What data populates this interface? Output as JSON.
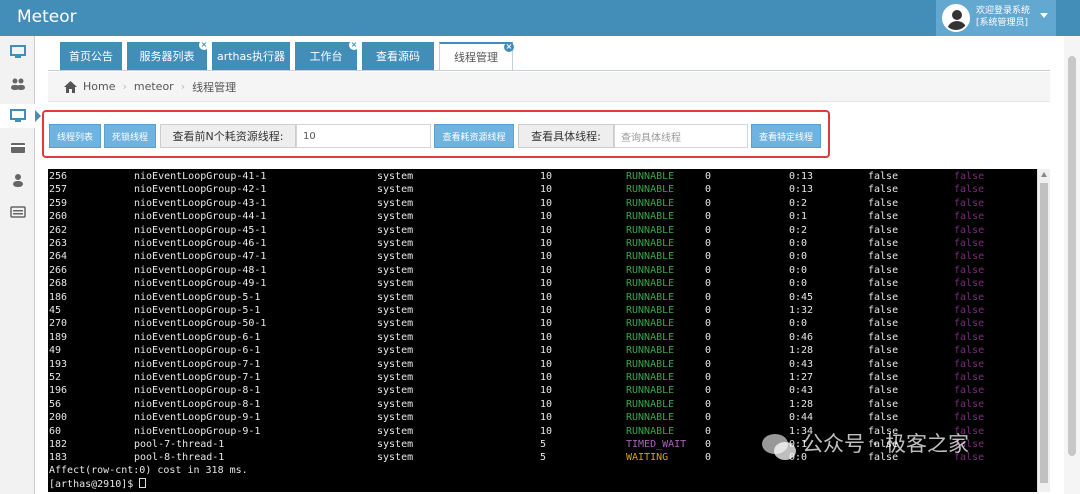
{
  "app": {
    "title": "Meteor"
  },
  "user": {
    "line1": "欢迎登录系统",
    "line2": "[系统管理员]"
  },
  "sidebar": {
    "items": [
      {
        "icon": "desktop-icon"
      },
      {
        "icon": "users-icon"
      },
      {
        "icon": "monitor-icon",
        "active": true
      },
      {
        "icon": "credit-card-icon"
      },
      {
        "icon": "user-icon"
      },
      {
        "icon": "list-icon"
      }
    ]
  },
  "tabs": [
    {
      "label": "首页公告",
      "closable": false
    },
    {
      "label": "服务器列表",
      "closable": true
    },
    {
      "label": "arthas执行器",
      "closable": false
    },
    {
      "label": "工作台",
      "closable": true
    },
    {
      "label": "查看源码",
      "closable": false
    },
    {
      "label": "线程管理",
      "closable": true,
      "active": true
    }
  ],
  "breadcrumb": {
    "home": "Home",
    "app": "meteor",
    "current": "线程管理"
  },
  "toolbar": {
    "thread_list": "线程列表",
    "deadlock": "死锁线程",
    "top_n_label": "查看前N个耗资源线程:",
    "top_n_value": "10",
    "top_n_button": "查看耗资源线程",
    "specific_label": "查看具体线程:",
    "specific_placeholder": "查询具体线程",
    "specific_button": "查看特定线程"
  },
  "console": {
    "rows": [
      [
        "256",
        "nioEventLoopGroup-41-1",
        "system",
        "10",
        "RUNNABLE",
        "0",
        "0:13",
        "false",
        "false"
      ],
      [
        "257",
        "nioEventLoopGroup-42-1",
        "system",
        "10",
        "RUNNABLE",
        "0",
        "0:13",
        "false",
        "false"
      ],
      [
        "259",
        "nioEventLoopGroup-43-1",
        "system",
        "10",
        "RUNNABLE",
        "0",
        "0:2",
        "false",
        "false"
      ],
      [
        "260",
        "nioEventLoopGroup-44-1",
        "system",
        "10",
        "RUNNABLE",
        "0",
        "0:1",
        "false",
        "false"
      ],
      [
        "262",
        "nioEventLoopGroup-45-1",
        "system",
        "10",
        "RUNNABLE",
        "0",
        "0:2",
        "false",
        "false"
      ],
      [
        "263",
        "nioEventLoopGroup-46-1",
        "system",
        "10",
        "RUNNABLE",
        "0",
        "0:0",
        "false",
        "false"
      ],
      [
        "264",
        "nioEventLoopGroup-47-1",
        "system",
        "10",
        "RUNNABLE",
        "0",
        "0:0",
        "false",
        "false"
      ],
      [
        "266",
        "nioEventLoopGroup-48-1",
        "system",
        "10",
        "RUNNABLE",
        "0",
        "0:0",
        "false",
        "false"
      ],
      [
        "268",
        "nioEventLoopGroup-49-1",
        "system",
        "10",
        "RUNNABLE",
        "0",
        "0:0",
        "false",
        "false"
      ],
      [
        "186",
        "nioEventLoopGroup-5-1",
        "system",
        "10",
        "RUNNABLE",
        "0",
        "0:45",
        "false",
        "false"
      ],
      [
        "45",
        "nioEventLoopGroup-5-1",
        "system",
        "10",
        "RUNNABLE",
        "0",
        "1:32",
        "false",
        "false"
      ],
      [
        "270",
        "nioEventLoopGroup-50-1",
        "system",
        "10",
        "RUNNABLE",
        "0",
        "0:0",
        "false",
        "false"
      ],
      [
        "189",
        "nioEventLoopGroup-6-1",
        "system",
        "10",
        "RUNNABLE",
        "0",
        "0:46",
        "false",
        "false"
      ],
      [
        "49",
        "nioEventLoopGroup-6-1",
        "system",
        "10",
        "RUNNABLE",
        "0",
        "1:28",
        "false",
        "false"
      ],
      [
        "193",
        "nioEventLoopGroup-7-1",
        "system",
        "10",
        "RUNNABLE",
        "0",
        "0:43",
        "false",
        "false"
      ],
      [
        "52",
        "nioEventLoopGroup-7-1",
        "system",
        "10",
        "RUNNABLE",
        "0",
        "1:27",
        "false",
        "false"
      ],
      [
        "196",
        "nioEventLoopGroup-8-1",
        "system",
        "10",
        "RUNNABLE",
        "0",
        "0:43",
        "false",
        "false"
      ],
      [
        "56",
        "nioEventLoopGroup-8-1",
        "system",
        "10",
        "RUNNABLE",
        "0",
        "1:28",
        "false",
        "false"
      ],
      [
        "200",
        "nioEventLoopGroup-9-1",
        "system",
        "10",
        "RUNNABLE",
        "0",
        "0:44",
        "false",
        "false"
      ],
      [
        "60",
        "nioEventLoopGroup-9-1",
        "system",
        "10",
        "RUNNABLE",
        "0",
        "1:34",
        "false",
        "false"
      ],
      [
        "182",
        "pool-7-thread-1",
        "system",
        "5",
        "TIMED_WAIT",
        "0",
        "0:1",
        "false",
        "false"
      ],
      [
        "183",
        "pool-8-thread-1",
        "system",
        "5",
        "WAITING",
        "0",
        "0:0",
        "false",
        "false"
      ]
    ],
    "summary": "Affect(row-cnt:0) cost in 318 ms.",
    "prompt": "[arthas@2910]$ "
  },
  "watermark": {
    "text": "公众号 · 极客之家"
  },
  "colors": {
    "topbar": "#438eb9",
    "tab": "#438eb9",
    "button": "#6fb3e0",
    "highlight_border": "#e23a3a",
    "runnable": "#3aa64a",
    "timed_wait": "#b05fc0",
    "waiting": "#d4a020"
  }
}
